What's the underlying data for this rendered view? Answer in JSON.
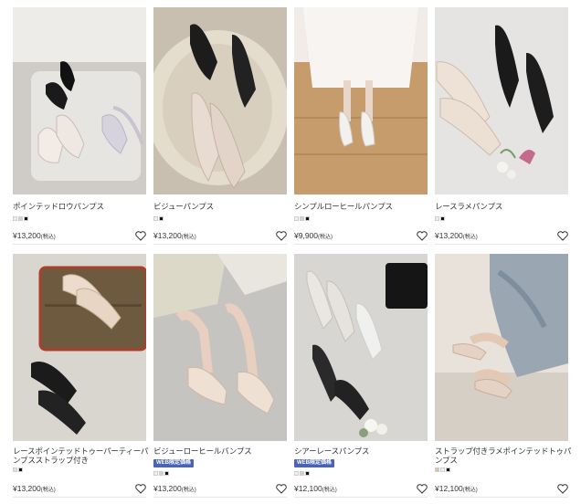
{
  "products": [
    {
      "name": "ポインテッドロウパンプス",
      "badge": "",
      "swatches": [
        "#efefef",
        "#d8d2c6",
        "#111111"
      ],
      "price": "¥13,200",
      "tax": "(税込)",
      "favorite_icon": "heart-icon"
    },
    {
      "name": "ビジューパンプス",
      "badge": "",
      "swatches": [
        "#efefef",
        "#111111"
      ],
      "price": "¥13,200",
      "tax": "(税込)",
      "favorite_icon": "heart-icon"
    },
    {
      "name": "シンプルローヒールパンプス",
      "badge": "",
      "swatches": [
        "#efefef",
        "#d8d2c6",
        "#111111"
      ],
      "price": "¥9,900",
      "tax": "(税込)",
      "favorite_icon": "heart-icon"
    },
    {
      "name": "レースラメパンプス",
      "badge": "",
      "swatches": [
        "#efefef",
        "#111111"
      ],
      "price": "¥13,200",
      "tax": "(税込)",
      "favorite_icon": "heart-icon"
    },
    {
      "name": "レースポインテッドトゥーパーティーパンプスストラップ付き",
      "badge": "",
      "swatches": [
        "#e9dfd2",
        "#111111"
      ],
      "price": "¥13,200",
      "tax": "(税込)",
      "favorite_icon": "heart-icon"
    },
    {
      "name": "ビジューローヒールパンプス",
      "badge": "WEB限定価格",
      "swatches": [
        "#efefef",
        "#d8d2c6",
        "#111111"
      ],
      "price": "¥13,200",
      "tax": "(税込)",
      "favorite_icon": "heart-icon"
    },
    {
      "name": "シアーレースパンプス",
      "badge": "WEB限定価格",
      "swatches": [
        "#efefef",
        "#d8d2c6",
        "#111111"
      ],
      "price": "¥12,100",
      "tax": "(税込)",
      "favorite_icon": "heart-icon"
    },
    {
      "name": "ストラップ付きラメポインテッドトゥパンプス",
      "badge": "",
      "swatches": [
        "#d8c3a6",
        "#efefef",
        "#111111"
      ],
      "price": "¥12,100",
      "tax": "(税込)",
      "favorite_icon": "heart-icon"
    }
  ],
  "colors": {
    "badge": "#4a63b5",
    "text": "#333333",
    "rule": "#e6e6e6"
  }
}
